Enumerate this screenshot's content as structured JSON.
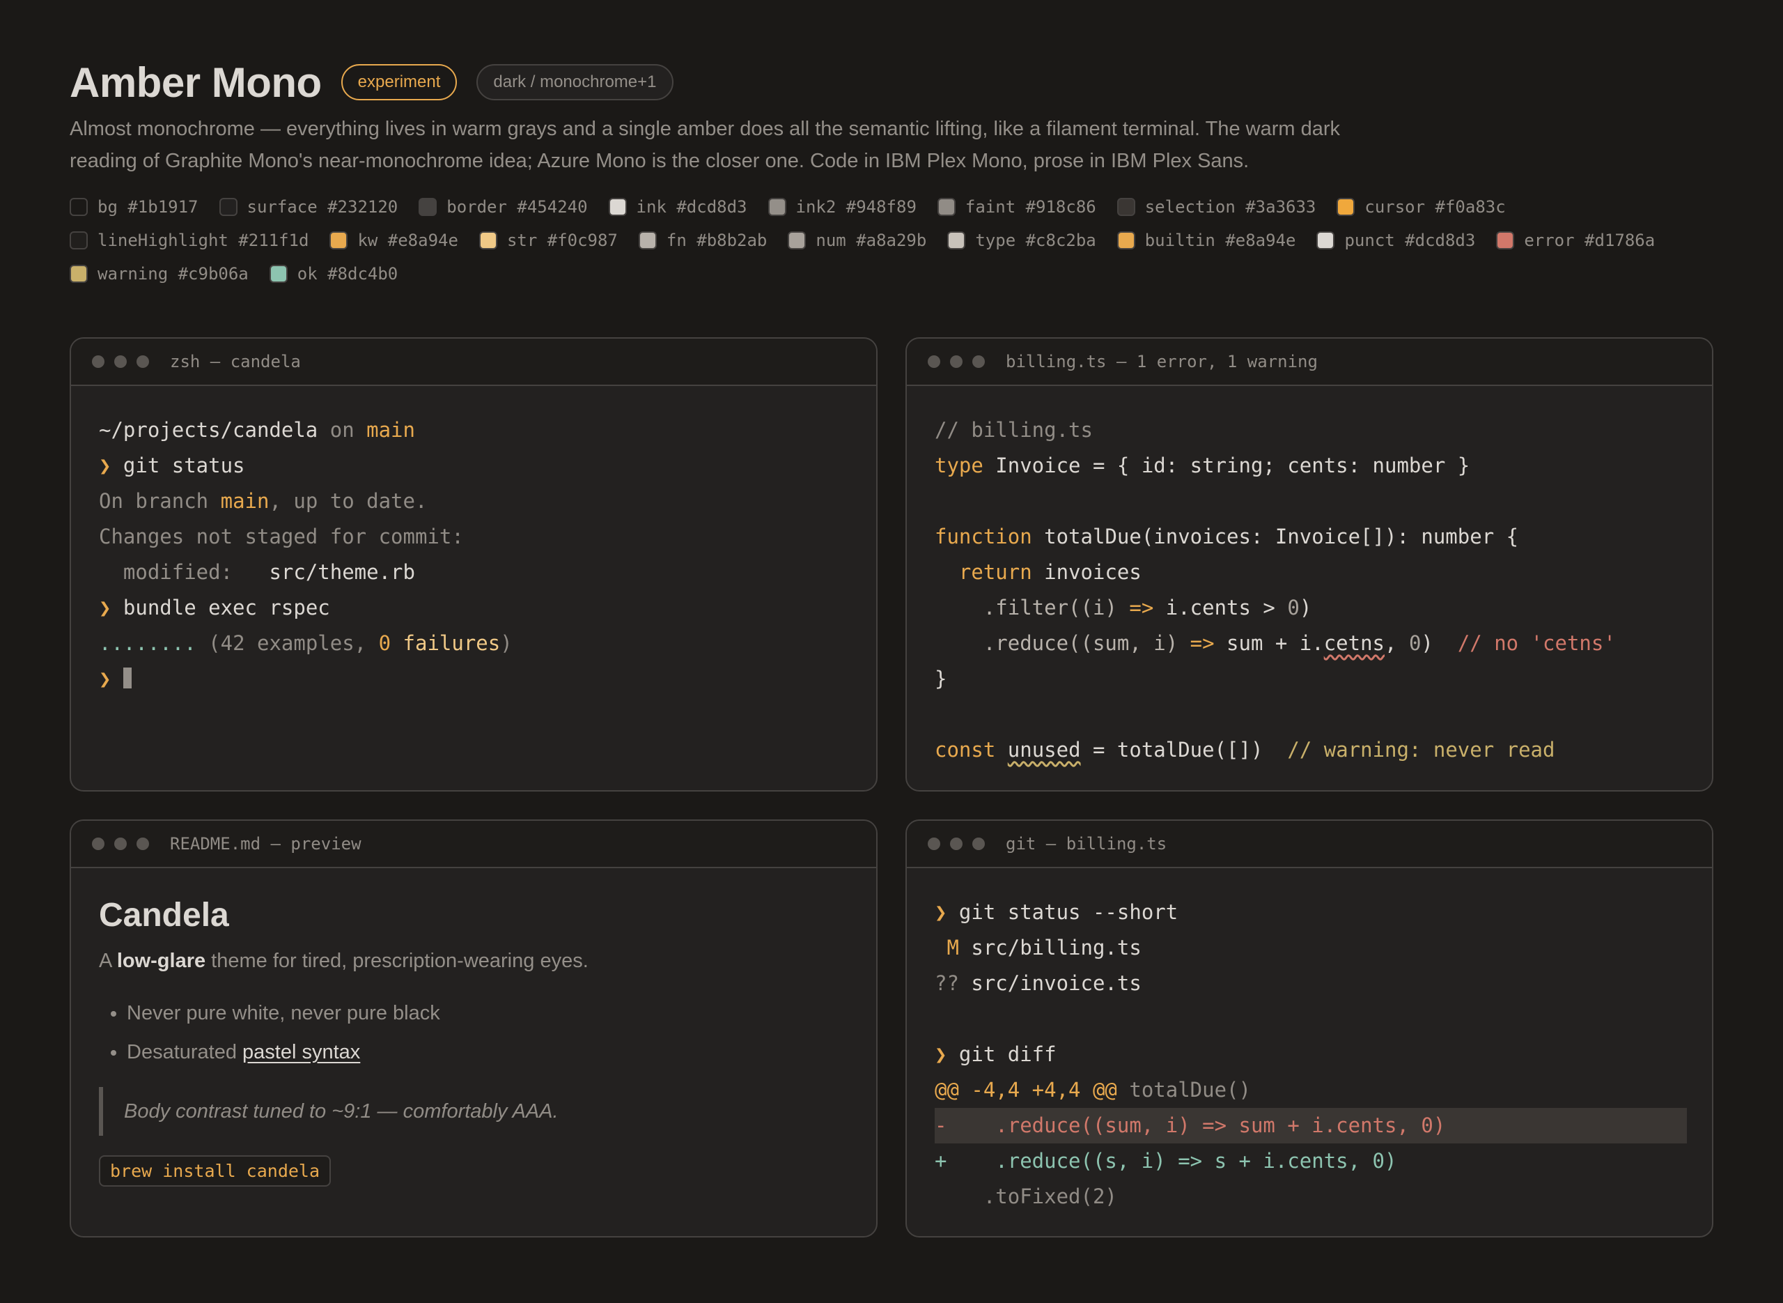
{
  "header": {
    "title": "Amber Mono",
    "badge_experiment": "experiment",
    "badge_mode": "dark / monochrome+1",
    "description": "Almost monochrome — everything lives in warm grays and a single amber does all the semantic lifting, like a filament terminal. The warm dark reading of Graphite Mono's near-monochrome idea; Azure Mono is the closer one. Code in IBM Plex Mono, prose in IBM Plex Sans."
  },
  "swatches": [
    {
      "label": "bg #1b1917",
      "color": "#1b1917"
    },
    {
      "label": "surface #232120",
      "color": "#232120"
    },
    {
      "label": "border #454240",
      "color": "#454240"
    },
    {
      "label": "ink #dcd8d3",
      "color": "#dcd8d3"
    },
    {
      "label": "ink2 #948f89",
      "color": "#948f89"
    },
    {
      "label": "faint #918c86",
      "color": "#918c86"
    },
    {
      "label": "selection #3a3633",
      "color": "#3a3633"
    },
    {
      "label": "cursor #f0a83c",
      "color": "#f0a83c"
    },
    {
      "label": "lineHighlight #211f1d",
      "color": "#211f1d"
    },
    {
      "label": "kw #e8a94e",
      "color": "#e8a94e"
    },
    {
      "label": "str #f0c987",
      "color": "#f0c987"
    },
    {
      "label": "fn #b8b2ab",
      "color": "#b8b2ab"
    },
    {
      "label": "num #a8a29b",
      "color": "#a8a29b"
    },
    {
      "label": "type #c8c2ba",
      "color": "#c8c2ba"
    },
    {
      "label": "builtin #e8a94e",
      "color": "#e8a94e"
    },
    {
      "label": "punct #dcd8d3",
      "color": "#dcd8d3"
    },
    {
      "label": "error #d1786a",
      "color": "#d1786a"
    },
    {
      "label": "warning #c9b06a",
      "color": "#c9b06a"
    },
    {
      "label": "ok #8dc4b0",
      "color": "#8dc4b0"
    }
  ],
  "terminal": {
    "title": "zsh — candela",
    "path": "~/projects/candela",
    "on": " on ",
    "branch": "main",
    "prompt": "❯ ",
    "cmd1": "git status",
    "out1_pre": "On branch ",
    "out1_branch": "main",
    "out1_post": ", up to date.",
    "out2": "Changes not staged for commit:",
    "out3_label": "  modified:   ",
    "out3_file": "src/theme.rb",
    "cmd2": "bundle exec rspec",
    "dots": "........",
    "res_pre": " (42 examples, ",
    "res_zero": "0",
    "res_fail": " failures",
    "res_post": ")"
  },
  "code": {
    "title": "billing.ts — 1 error, 1 warning",
    "comment": "// billing.ts",
    "kw_type": "type",
    "type_rest": " Invoice = { id: string; cents: number }",
    "kw_function": "function",
    "fn_rest": " totalDue(invoices: Invoice[]): number {",
    "kw_return": "  return",
    "return_rest": " invoices",
    "filter_pre": "    .filter((i) ",
    "arrow": "=>",
    "filter_mid": " i.cents > ",
    "zero": "0",
    "filter_post": ")",
    "reduce_pre": "    .reduce((sum, i) ",
    "reduce_mid": " sum + i.",
    "typo": "cetns",
    "reduce_comma": ", ",
    "reduce_post": ")  ",
    "err_comment": "// no 'cetns'",
    "close": "}",
    "kw_const": "const",
    "unused": "unused",
    "const_rest": " = totalDue([])  ",
    "warn_comment": "// warning: never read"
  },
  "readme": {
    "title": "README.md — preview",
    "h1": "Candela",
    "p_pre": "A ",
    "p_bold": "low-glare",
    "p_post": " theme for tired, prescription-wearing eyes.",
    "li1": "Never pure white, never pure black",
    "li2_pre": "Desaturated ",
    "li2_link": "pastel syntax",
    "quote": "Body contrast tuned to ~9:1 — comfortably AAA.",
    "code": "brew install candela"
  },
  "git": {
    "title": "git — billing.ts",
    "prompt": "❯ ",
    "cmd1": "git status --short",
    "m_flag": " M",
    "m_file": " src/billing.ts",
    "q_flag": "??",
    "q_file": " src/invoice.ts",
    "cmd2": "git diff",
    "hunk": "@@ -4,4 +4,4 @@",
    "hunk_ctx": " totalDue()",
    "del": "-    .reduce((sum, i) => sum + i.cents, 0)",
    "add": "+    .reduce((s, i) => s + i.cents, 0)",
    "ctx": "    .toFixed(2)"
  }
}
